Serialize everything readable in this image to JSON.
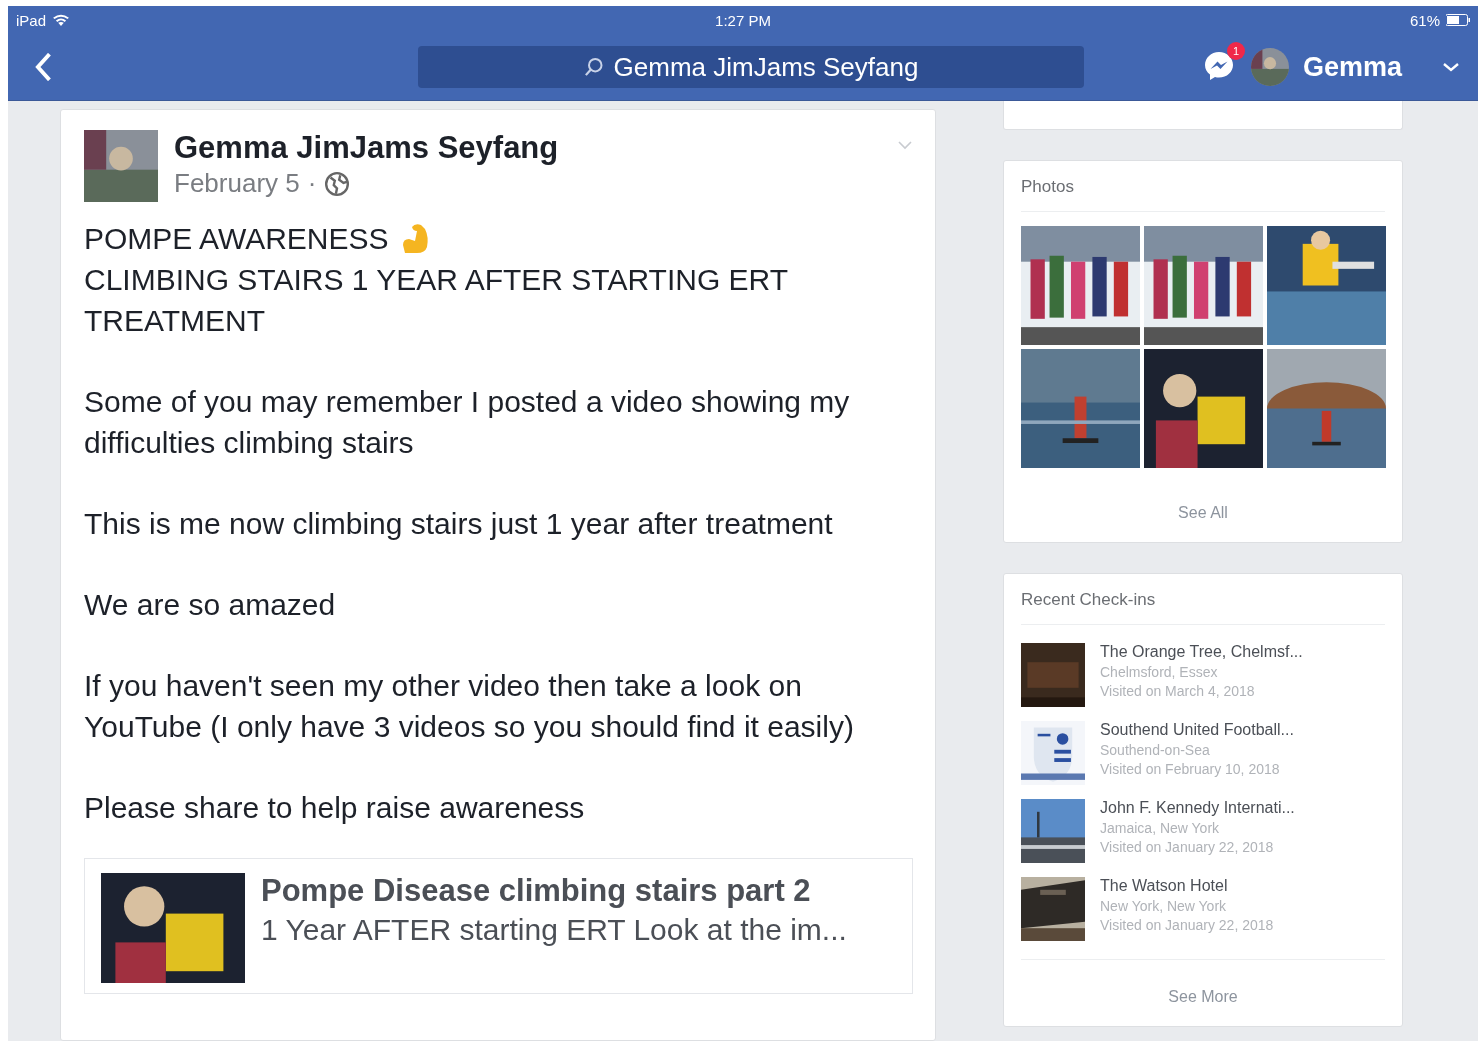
{
  "status_bar": {
    "device": "iPad",
    "time": "1:27 PM",
    "battery": "61%"
  },
  "nav": {
    "search": {
      "value": "Gemma JimJams Seyfang"
    },
    "messages_badge": "1",
    "user": "Gemma"
  },
  "post": {
    "author": "Gemma JimJams Seyfang",
    "date": "February 5",
    "separator": "·",
    "headline": "POMPE AWARENESS",
    "subhead": "CLIMBING STAIRS 1 YEAR AFTER STARTING ERT TREATMENT",
    "paragraphs": [
      "Some of you may remember I posted a video showing my difficulties climbing stairs",
      "This is me now climbing stairs just 1 year after treatment",
      "We are so amazed",
      "If you haven't seen my other video then take a look on YouTube (I only have 3 videos so you should find it easily)",
      "Please share to help raise awareness"
    ],
    "link": {
      "title": "Pompe Disease climbing stairs part 2",
      "description": "1 Year AFTER starting ERT Look at the im..."
    }
  },
  "photos": {
    "title": "Photos",
    "see_all": "See All"
  },
  "checkins": {
    "title": "Recent Check-ins",
    "items": [
      {
        "name": "The Orange Tree, Chelmsf...",
        "location": "Chelmsford, Essex",
        "visited": "Visited on March 4, 2018"
      },
      {
        "name": "Southend United Football...",
        "location": "Southend-on-Sea",
        "visited": "Visited on February 10, 2018"
      },
      {
        "name": "John F. Kennedy Internati...",
        "location": "Jamaica, New York",
        "visited": "Visited on January 22, 2018"
      },
      {
        "name": "The Watson Hotel",
        "location": "New York, New York",
        "visited": "Visited on January 22, 2018"
      }
    ],
    "see_more": "See More"
  }
}
